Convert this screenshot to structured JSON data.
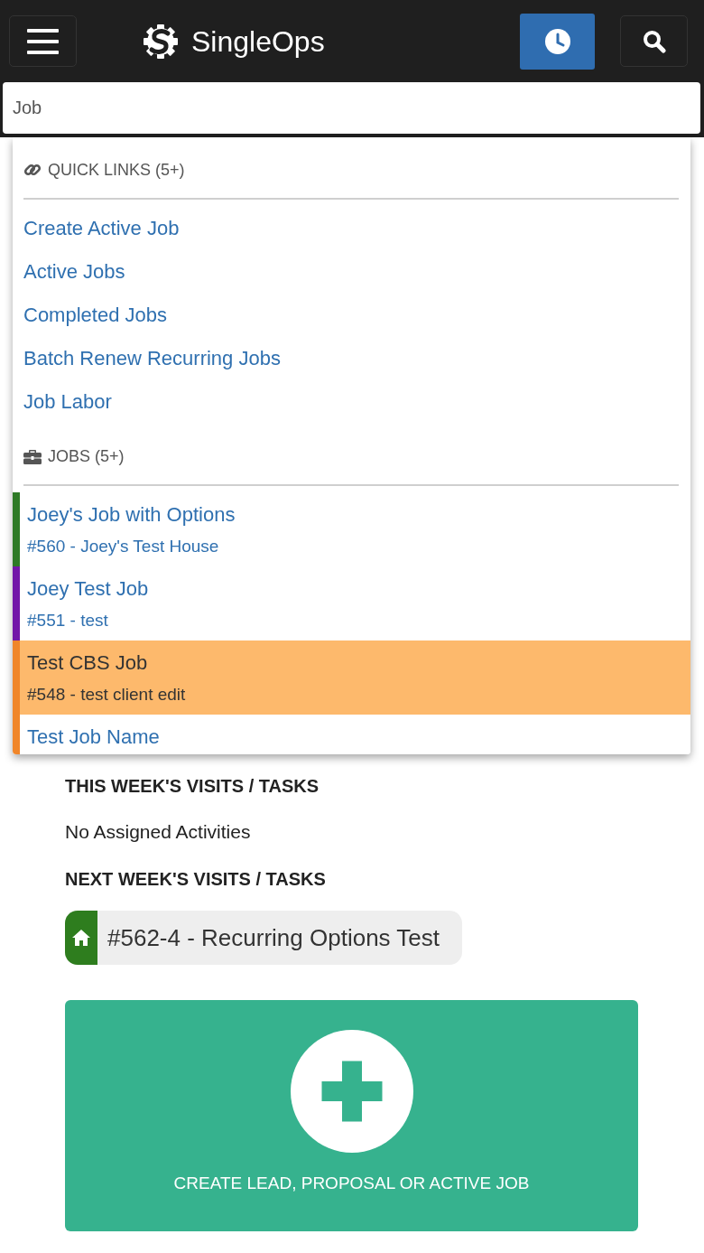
{
  "navbar": {
    "brand": "SingleOps"
  },
  "search": {
    "value": "Job"
  },
  "results": {
    "sections": [
      {
        "kind": "links",
        "heading": "QUICK LINKS (5+)",
        "items": [
          {
            "label": "Create Active Job"
          },
          {
            "label": "Active Jobs"
          },
          {
            "label": "Completed Jobs"
          },
          {
            "label": "Batch Renew Recurring Jobs"
          },
          {
            "label": "Job Labor"
          }
        ]
      },
      {
        "kind": "jobs",
        "heading": "JOBS (5+)",
        "items": [
          {
            "title": "Joey's Job with Options",
            "subtitle": "#560 - Joey's Test House",
            "color": "#2e7a26",
            "selected": false
          },
          {
            "title": "Joey Test Job",
            "subtitle": "#551 - test",
            "color": "#7216a8",
            "selected": false
          },
          {
            "title": "Test CBS Job",
            "subtitle": "#548 - test client edit",
            "color": "#f0862a",
            "selected": true
          },
          {
            "title": "Test Job Name",
            "color": "#f0862a",
            "selected": false
          }
        ]
      }
    ]
  },
  "this_week": {
    "heading": "THIS WEEK'S VISITS / TASKS",
    "empty_text": "No Assigned Activities"
  },
  "next_week": {
    "heading": "NEXT WEEK'S VISITS / TASKS",
    "items": [
      {
        "label": "#562-4 - Recurring Options Test",
        "color": "#2e7d1e"
      }
    ]
  },
  "create_button": {
    "label": "CREATE LEAD, PROPOSAL OR ACTIVE JOB"
  }
}
